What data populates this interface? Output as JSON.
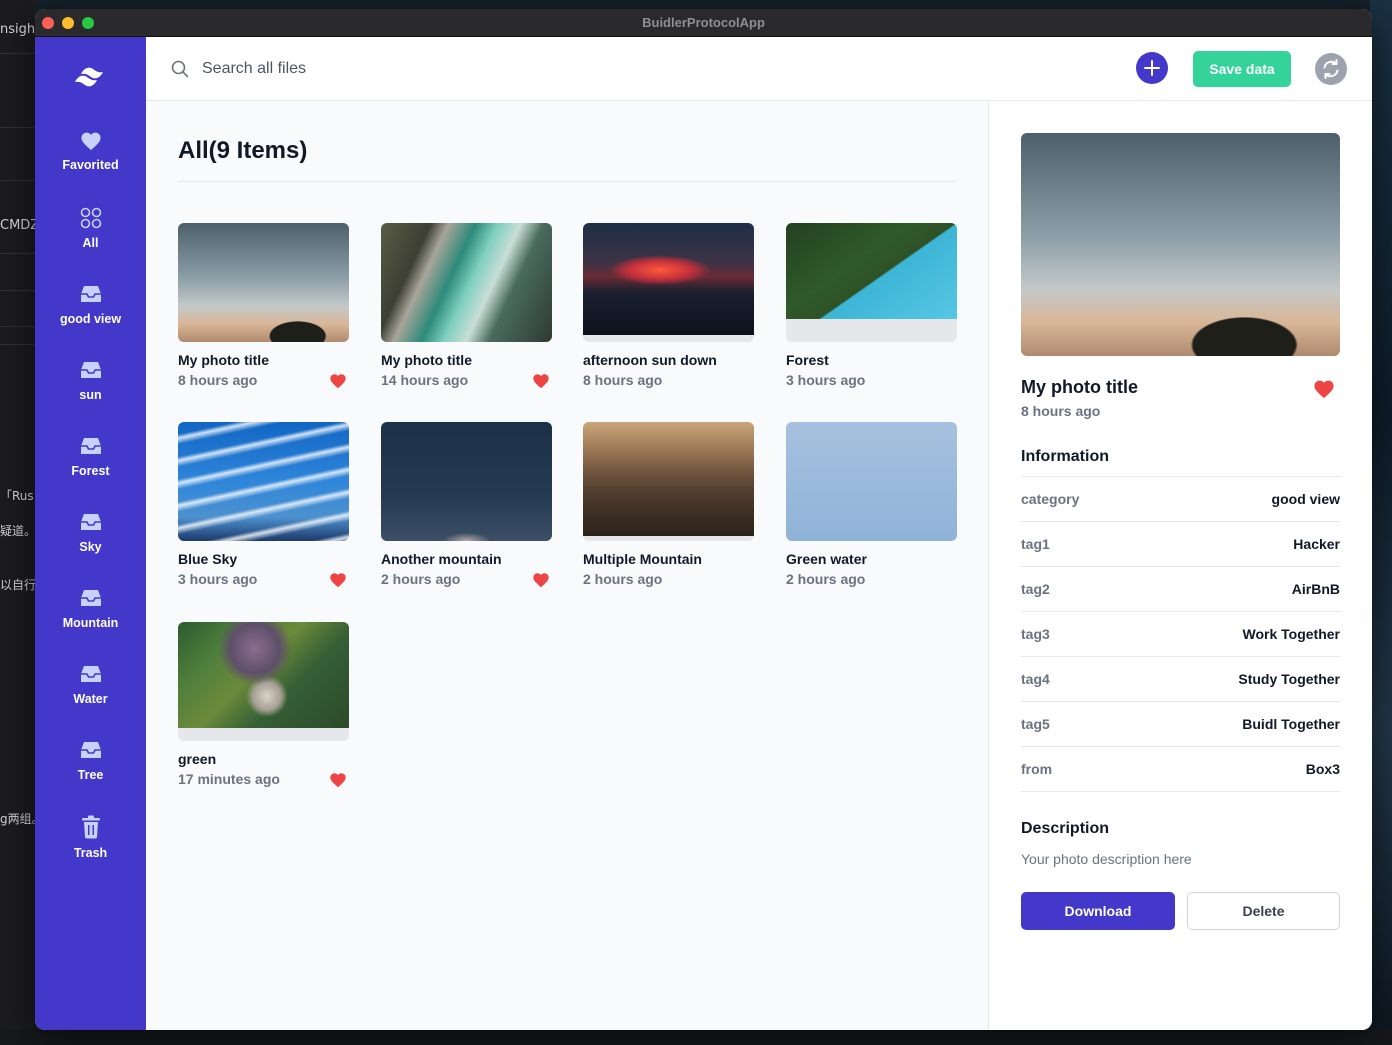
{
  "window": {
    "title": "BuidlerProtocolApp"
  },
  "desktop_fragments": [
    "nsigh",
    "CMDZ",
    "「Rus",
    "疑道。无",
    "以自行",
    "g两组。"
  ],
  "sidebar": {
    "items": [
      {
        "label": "Favorited",
        "icon": "heart-icon"
      },
      {
        "label": "All",
        "icon": "grid-icon"
      },
      {
        "label": "good view",
        "icon": "inbox-icon"
      },
      {
        "label": "sun",
        "icon": "inbox-icon"
      },
      {
        "label": "Forest",
        "icon": "inbox-icon"
      },
      {
        "label": "Sky",
        "icon": "inbox-icon"
      },
      {
        "label": "Mountain",
        "icon": "inbox-icon"
      },
      {
        "label": "Water",
        "icon": "inbox-icon"
      },
      {
        "label": "Tree",
        "icon": "inbox-icon"
      },
      {
        "label": "Trash",
        "icon": "trash-icon"
      }
    ]
  },
  "topbar": {
    "search_placeholder": "Search all files",
    "save_label": "Save data"
  },
  "main": {
    "title": "All(9 Items)",
    "files": [
      {
        "title": "My photo title",
        "time": "8 hours ago",
        "favorited": true,
        "image": "sunset-tree"
      },
      {
        "title": "My photo title",
        "time": "14 hours ago",
        "favorited": true,
        "image": "aerial-beach"
      },
      {
        "title": "afternoon sun down",
        "time": "8 hours ago",
        "favorited": false,
        "image": "red-sunset"
      },
      {
        "title": "Forest",
        "time": "3 hours ago",
        "favorited": false,
        "image": "forest-lake"
      },
      {
        "title": "Blue Sky",
        "time": "3 hours ago",
        "favorited": true,
        "image": "blue-sky"
      },
      {
        "title": "Another mountain",
        "time": "2 hours ago",
        "favorited": true,
        "image": "dark-mountain"
      },
      {
        "title": "Multiple Mountain",
        "time": "2 hours ago",
        "favorited": false,
        "image": "mountain-ranges"
      },
      {
        "title": "Green water",
        "time": "2 hours ago",
        "favorited": false,
        "image": "pale-blue"
      },
      {
        "title": "green",
        "time": "17 minutes ago",
        "favorited": true,
        "image": "succulents"
      }
    ]
  },
  "detail": {
    "title": "My photo title",
    "time": "8 hours ago",
    "favorited": true,
    "information_heading": "Information",
    "info": [
      {
        "key": "category",
        "value": "good view"
      },
      {
        "key": "tag1",
        "value": "Hacker"
      },
      {
        "key": "tag2",
        "value": "AirBnB"
      },
      {
        "key": "tag3",
        "value": "Work Together"
      },
      {
        "key": "tag4",
        "value": "Study Together"
      },
      {
        "key": "tag5",
        "value": "Buidl Together"
      },
      {
        "key": "from",
        "value": "Box3"
      }
    ],
    "description_heading": "Description",
    "description": "Your photo description here",
    "download_label": "Download",
    "delete_label": "Delete"
  },
  "colors": {
    "sidebar": "#4338ca",
    "accent": "#4338ca",
    "save": "#34d399",
    "heart": "#ef4444"
  }
}
